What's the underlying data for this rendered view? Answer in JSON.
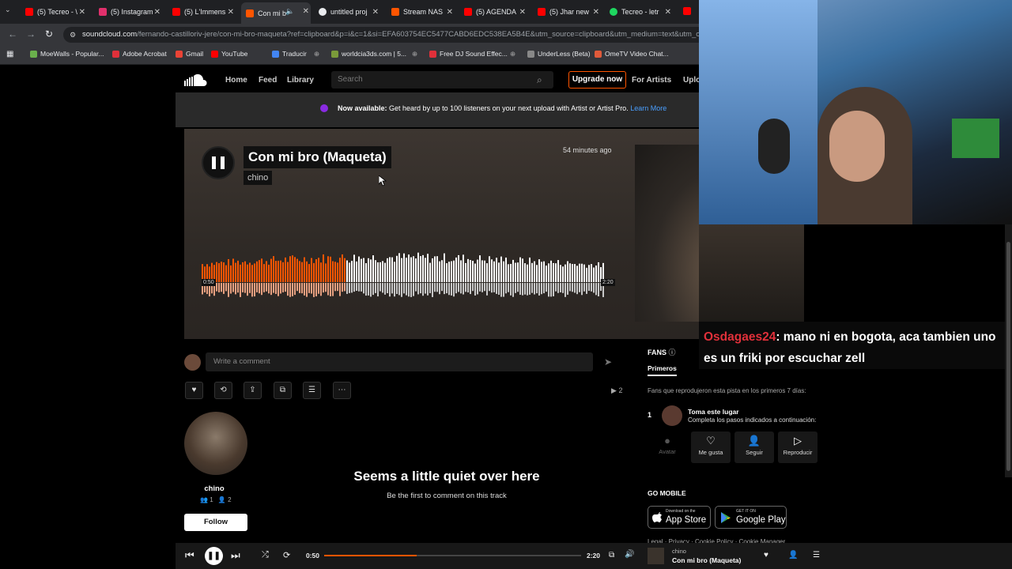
{
  "browser": {
    "tabs": [
      {
        "label": "(5) Tecreo - \\",
        "color": "#ff0000"
      },
      {
        "label": "(5) Instagram",
        "color": "#e1306c"
      },
      {
        "label": "(5) L'Immens",
        "color": "#ff0000"
      },
      {
        "label": "Con mi b",
        "color": "#ff5500",
        "active": true
      },
      {
        "label": "untitled proj",
        "color": "#8ab4f8"
      },
      {
        "label": "Stream NAS",
        "color": "#ff5500"
      },
      {
        "label": "(5) AGENDA",
        "color": "#ff0000"
      },
      {
        "label": "(5) Jhar new",
        "color": "#ff0000"
      },
      {
        "label": "Tecreo - letr",
        "color": "#1ed760"
      }
    ],
    "url_host": "soundcloud.com",
    "url_path": "/fernando-castilloriv-jere/con-mi-bro-maqueta?ref=clipboard&p=i&c=1&si=EFA603754EC5477CABD6EDC538EA5B4E&utm_source=clipboard&utm_medium=text&utm_cam",
    "bookmarks": [
      {
        "label": "MoeWalls - Popular...",
        "color": "#6ab04c"
      },
      {
        "label": "Adobe Acrobat",
        "color": "#e0303a"
      },
      {
        "label": "Gmail",
        "color": "#ea4335"
      },
      {
        "label": "YouTube",
        "color": "#ff0000"
      },
      {
        "label": "Traducir",
        "color": "#4285f4"
      },
      {
        "label": "worldcia3ds.com | 5...",
        "color": "#7a9a3a"
      },
      {
        "label": "Free DJ Sound Effec...",
        "color": "#e0303a"
      },
      {
        "label": "UnderLess (Beta)",
        "color": "#888888"
      },
      {
        "label": "OmeTV Video Chat...",
        "color": "#e05a3a"
      }
    ]
  },
  "header": {
    "nav": [
      "Home",
      "Feed",
      "Library"
    ],
    "search_placeholder": "Search",
    "upgrade": "Upgrade now",
    "for_artists": "For Artists",
    "upload": "Uplo"
  },
  "banner": {
    "bold": "Now available:",
    "text": " Get heard by up to 100 listeners on your next upload with Artist or Artist Pro.",
    "link": "Learn More"
  },
  "track": {
    "title": "Con mi bro (Maqueta)",
    "artist": "chino",
    "time_ago": "54 minutes ago",
    "current_time": "0:50",
    "duration": "2:20",
    "played_fraction": 0.36,
    "accent": "#ff5500"
  },
  "stream_chat": {
    "user": "Osdagaes24",
    "message": ": mano ni en bogota, aca tambien uno es un friki por escuchar zell"
  },
  "comment": {
    "placeholder": "Write a comment"
  },
  "actions": {
    "plays": "2"
  },
  "profile": {
    "name": "chino",
    "followers": "1",
    "following": "2",
    "follow": "Follow"
  },
  "empty": {
    "title": "Seems a little quiet over here",
    "subtitle": "Be the first to comment on this track"
  },
  "fans": {
    "title": "FANS",
    "tab": "Primeros",
    "desc": "Fans que reprodujeron esta pista en los primeros 7 días:",
    "rank": "1",
    "entry_title": "Toma este lugar",
    "entry_sub": "Completa los pasos indicados a continuación:",
    "steps": [
      {
        "label": "Avatar",
        "icon": "avatar-icon"
      },
      {
        "label": "Me gusta",
        "icon": "heart-icon"
      },
      {
        "label": "Seguir",
        "icon": "user-plus-icon"
      },
      {
        "label": "Reproducir",
        "icon": "play-icon"
      }
    ]
  },
  "mobile": {
    "title": "GO MOBILE",
    "appstore_small": "Download on the",
    "appstore": "App Store",
    "gplay_small": "GET IT ON",
    "gplay": "Google Play"
  },
  "footer_links": "Legal · Privacy · Cookie Policy · Cookie Manager",
  "player": {
    "artist": "chino",
    "track": "Con mi bro (Maqueta)",
    "current": "0:50",
    "duration": "2:20",
    "progress": 0.36
  }
}
